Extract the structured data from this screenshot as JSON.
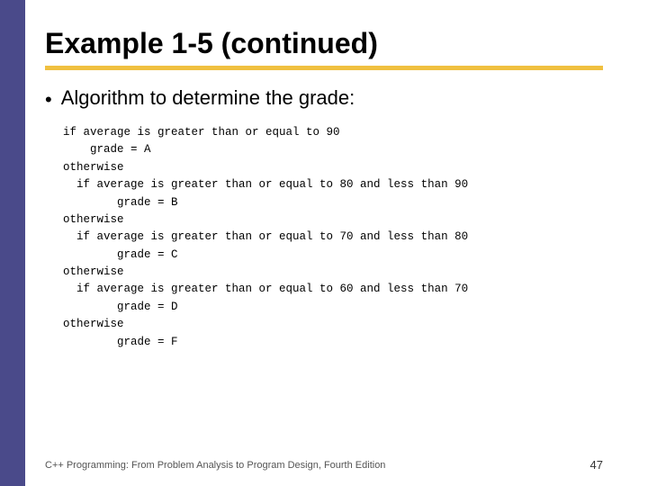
{
  "slide": {
    "title": "Example 1-5 (continued)",
    "bullet": "Algorithm to determine the grade:",
    "code": "if average is greater than or equal to 90\n    grade = A\notherwise\n  if average is greater than or equal to 80 and less than 90\n        grade = B\notherwise\n  if average is greater than or equal to 70 and less than 80\n        grade = C\notherwise\n  if average is greater than or equal to 60 and less than 70\n        grade = D\notherwise\n        grade = F",
    "footer_text": "C++ Programming: From Problem Analysis to Program Design, Fourth Edition",
    "page_number": "47",
    "accent_color": "#f0c040",
    "left_bar_color": "#4a4a8a"
  }
}
